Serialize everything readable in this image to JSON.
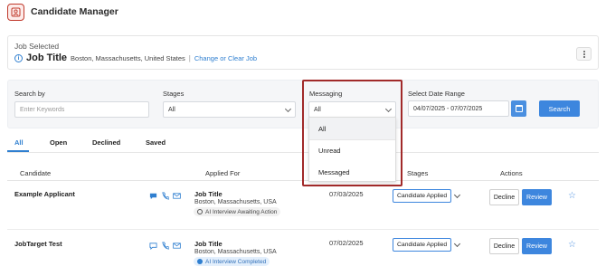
{
  "app": {
    "title": "Candidate Manager"
  },
  "job": {
    "selected_label": "Job Selected",
    "title": "Job Title",
    "location": "Boston, Massachusetts, United States",
    "separator": "|",
    "change_link": "Change or Clear Job"
  },
  "filters": {
    "search": {
      "label": "Search by",
      "placeholder": "Enter Keywords"
    },
    "stages": {
      "label": "Stages",
      "value": "All"
    },
    "messaging": {
      "label": "Messaging",
      "value": "All",
      "options": [
        "All",
        "Unread",
        "Messaged"
      ],
      "selected_index": 0
    },
    "date_range": {
      "label": "Select Date Range",
      "value": "04/07/2025 - 07/07/2025"
    },
    "search_button": "Search"
  },
  "tabs": [
    {
      "label": "All",
      "active": true
    },
    {
      "label": "Open",
      "active": false
    },
    {
      "label": "Declined",
      "active": false
    },
    {
      "label": "Saved",
      "active": false
    }
  ],
  "table": {
    "columns": {
      "candidate": "Candidate",
      "applied_for": "Applied For",
      "stages": "Stages",
      "actions": "Actions"
    },
    "rows": [
      {
        "name": "Example Applicant",
        "job_title": "Job Title",
        "location": "Boston, Massachusetts, USA",
        "ai_status": "AI Interview Awaiting Action",
        "date": "07/03/2025",
        "stage": "Candidate Applied",
        "decline": "Decline",
        "review": "Review"
      },
      {
        "name": "JobTarget Test",
        "job_title": "Job Title",
        "location": "Boston, Massachusetts, USA",
        "ai_status": "AI Interview Completed",
        "date": "07/02/2025",
        "stage": "Candidate Applied",
        "decline": "Decline",
        "review": "Review"
      }
    ]
  },
  "colors": {
    "accent": "#3d86de",
    "highlight": "#a12a2a",
    "brand": "#c0392b"
  },
  "icons": [
    "candidate-manager-logo-icon",
    "info-icon",
    "kebab-menu-icon",
    "calendar-icon",
    "chat-icon",
    "phone-icon",
    "mail-icon",
    "star-icon",
    "chevron-down-icon"
  ]
}
